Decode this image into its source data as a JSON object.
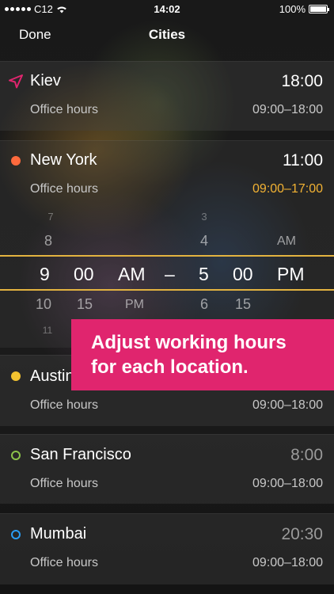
{
  "status_bar": {
    "carrier": "C12",
    "time": "14:02",
    "battery": "100%"
  },
  "nav": {
    "done_label": "Done",
    "title": "Cities"
  },
  "cities": [
    {
      "name": "Kiev",
      "time": "18:00",
      "hours_label": "Office hours",
      "hours": "09:00–18:00",
      "marker": "location-arrow-icon",
      "color": "#e0256e"
    },
    {
      "name": "New York",
      "time": "11:00",
      "hours_label": "Office hours",
      "hours": "09:00–17:00",
      "marker": "filled-dot",
      "color": "#ff6a3d",
      "hours_color": "#f2b233"
    },
    {
      "name": "Austin",
      "time": "",
      "hours_label": "Office hours",
      "hours": "09:00–18:00",
      "marker": "filled-dot",
      "color": "#f2c230"
    },
    {
      "name": "San Francisco",
      "time": "8:00",
      "hours_label": "Office hours",
      "hours": "09:00–18:00",
      "marker": "ring-dot",
      "color": "#8bc34a"
    },
    {
      "name": "Mumbai",
      "time": "20:30",
      "hours_label": "Office hours",
      "hours": "09:00–18:00",
      "marker": "ring-dot",
      "color": "#2a9df4"
    }
  ],
  "picker": {
    "above2": {
      "start_hour": "7",
      "end_hour": "3"
    },
    "above1": {
      "start_hour": "8",
      "end_hour": "4",
      "end_period": "AM"
    },
    "selected": {
      "start_hour": "9",
      "start_min": "00",
      "start_period": "AM",
      "separator": "–",
      "end_hour": "5",
      "end_min": "00",
      "end_period": "PM"
    },
    "below1": {
      "start_hour": "10",
      "start_min": "15",
      "start_period": "PM",
      "end_hour": "6",
      "end_min": "15"
    },
    "below2": {
      "start_hour": "11"
    },
    "accent": "#e3b340"
  },
  "promo": {
    "line1": "Adjust working hours",
    "line2": "for each location.",
    "color": "#e0256e"
  }
}
